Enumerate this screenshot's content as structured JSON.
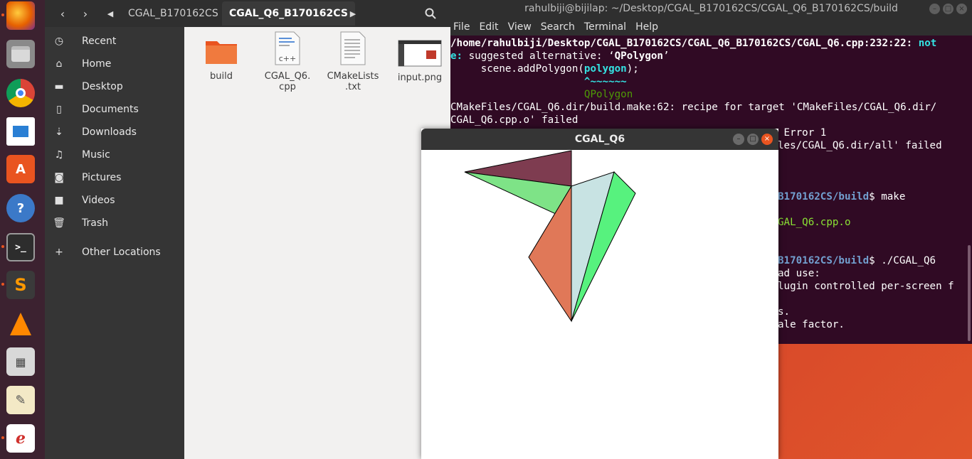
{
  "file_manager": {
    "breadcrumbs": [
      "CGAL_B170162CS",
      "CGAL_Q6_B170162CS"
    ],
    "sidebar": [
      {
        "label": "Recent",
        "icon": "clock-icon"
      },
      {
        "label": "Home",
        "icon": "home-icon"
      },
      {
        "label": "Desktop",
        "icon": "folder-icon"
      },
      {
        "label": "Documents",
        "icon": "document-icon"
      },
      {
        "label": "Downloads",
        "icon": "download-icon"
      },
      {
        "label": "Music",
        "icon": "music-icon"
      },
      {
        "label": "Pictures",
        "icon": "camera-icon"
      },
      {
        "label": "Videos",
        "icon": "video-icon"
      },
      {
        "label": "Trash",
        "icon": "trash-icon"
      },
      {
        "label": "Other Locations",
        "icon": "plus-icon"
      }
    ],
    "files": [
      {
        "line1": "build",
        "line2": ""
      },
      {
        "line1": "CGAL_Q6.",
        "line2": "cpp"
      },
      {
        "line1": "CMakeLists",
        "line2": ".txt"
      },
      {
        "line1": "input.png",
        "line2": ""
      }
    ]
  },
  "terminal": {
    "title": "rahulbiji@bijilap: ~/Desktop/CGAL_B170162CS/CGAL_Q6_B170162CS/build",
    "menu": [
      "File",
      "Edit",
      "View",
      "Search",
      "Terminal",
      "Help"
    ],
    "lines": {
      "l1a": "/home/rahulbiji/Desktop/CGAL_B170162CS/CGAL_Q6_B170162CS/CGAL_Q6.cpp:232:22: ",
      "l1b": "not",
      "l2a": "e:",
      "l2b": " suggested alternative: ‘",
      "l2c": "QPolygon",
      "l2d": "’",
      "l3a": "     scene.addPolygon(",
      "l3b": "polygon",
      "l3c": ");",
      "l4": "                      ^~~~~~~",
      "l5": "                      QPolygon",
      "l6": "CMakeFiles/CGAL_Q6.dir/build.make:62: recipe for target 'CMakeFiles/CGAL_Q6.dir/",
      "l7": "CGAL_Q6.cpp.o' failed",
      "l8": " Error 1",
      "l9": "les/CGAL_Q6.dir/all' failed",
      "l10a": "B170162CS/build",
      "l10b": "$ make",
      "l11": "GAL_Q6.cpp.o",
      "l12a": "B170162CS/build",
      "l12b": "$ ./CGAL_Q6",
      "l13": "ad use:",
      "l14": "lugin controlled per-screen f",
      "l15": "s.",
      "l16": "ale factor."
    }
  },
  "cgal_window": {
    "title": "CGAL_Q6",
    "colors": {
      "maroon": "#7e3c50",
      "light_green": "#7ee387",
      "dark_blue": "#2d3d8a",
      "salmon": "#e07858",
      "light_cyan": "#c8e3e3",
      "bright_green": "#57f27e"
    }
  }
}
